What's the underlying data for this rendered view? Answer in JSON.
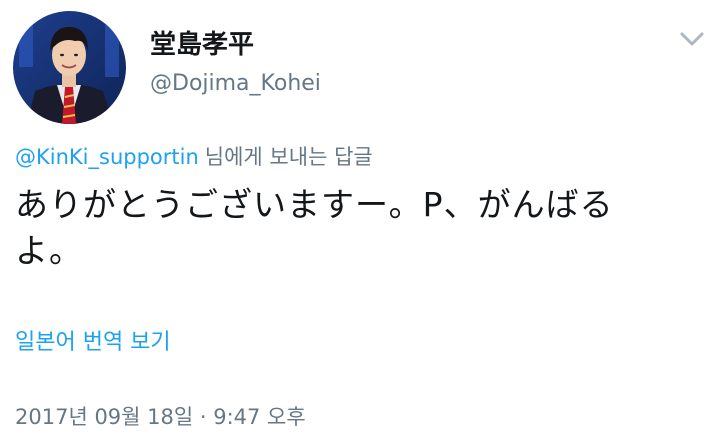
{
  "tweet": {
    "author": {
      "display_name": "堂島孝平",
      "handle": "@Dojima_Kohei",
      "avatar": "profile-photo"
    },
    "menu_icon": "chevron-down-icon",
    "reply_to": {
      "mention": "@KinKi_supportin",
      "suffix": "님에게 보내는 답글"
    },
    "text": "ありがとうございますー。P、がんばるよ。",
    "translate_label": "일본어 번역 보기",
    "timestamp": "2017년 09월 18일 · 9:47 오후"
  },
  "colors": {
    "link": "#1da1f2",
    "secondary_text": "#657786",
    "primary_text": "#14171a",
    "background": "#ffffff"
  }
}
